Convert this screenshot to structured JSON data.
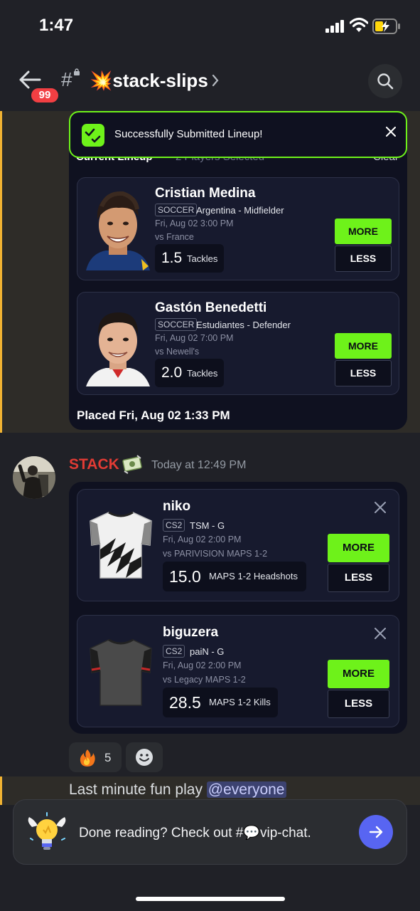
{
  "status_bar": {
    "time": "1:47"
  },
  "header": {
    "back_badge": "99",
    "hash": "#",
    "channel_name": "💥stack-slips"
  },
  "toast": {
    "text": "Successfully Submitted Lineup!"
  },
  "lineup_partial": {
    "left": "Current Lineup",
    "middle": "2 Players Selected",
    "right": "Clear"
  },
  "lineup1": {
    "players": [
      {
        "name": "Cristian Medina",
        "sport": "SOCCER",
        "team": "Argentina - Midfielder",
        "date": "Fri, Aug 02 3:00 PM",
        "opponent": "vs France",
        "stat_value": "1.5",
        "stat_label": "Tackles",
        "more": "MORE",
        "less": "LESS"
      },
      {
        "name": "Gastón Benedetti",
        "sport": "SOCCER",
        "team": "Estudiantes - Defender",
        "date": "Fri, Aug 02 7:00 PM",
        "opponent": "vs Newell's",
        "stat_value": "2.0",
        "stat_label": "Tackles",
        "more": "MORE",
        "less": "LESS"
      }
    ],
    "placed": "Placed Fri, Aug 02 1:33 PM"
  },
  "message": {
    "author": "STACK",
    "timestamp": "Today at 12:49 PM"
  },
  "lineup2": {
    "players": [
      {
        "name": "niko",
        "sport": "CS2",
        "team": "TSM - G",
        "date": "Fri, Aug 02 2:00 PM",
        "opponent": "vs PARIVISION MAPS 1-2",
        "stat_value": "15.0",
        "stat_label": "MAPS 1-2 Headshots",
        "more": "MORE",
        "less": "LESS"
      },
      {
        "name": "biguzera",
        "sport": "CS2",
        "team": "paiN - G",
        "date": "Fri, Aug 02 2:00 PM",
        "opponent": "vs Legacy MAPS 1-2",
        "stat_value": "28.5",
        "stat_label": "MAPS 1-2 Kills",
        "more": "MORE",
        "less": "LESS"
      }
    ]
  },
  "reactions": [
    {
      "emoji": "🔥",
      "count": "5"
    }
  ],
  "last_message": {
    "text": "Last minute fun play ",
    "mention": "@everyone"
  },
  "banner": {
    "text": "Done reading? Check out #💬vip-chat."
  },
  "colors": {
    "accent_green": "#6ef21a",
    "brand_blurple": "#5865f2",
    "badge_red": "#f23f43",
    "author_red": "#e23b34",
    "highlight_bar": "#f0b232"
  }
}
